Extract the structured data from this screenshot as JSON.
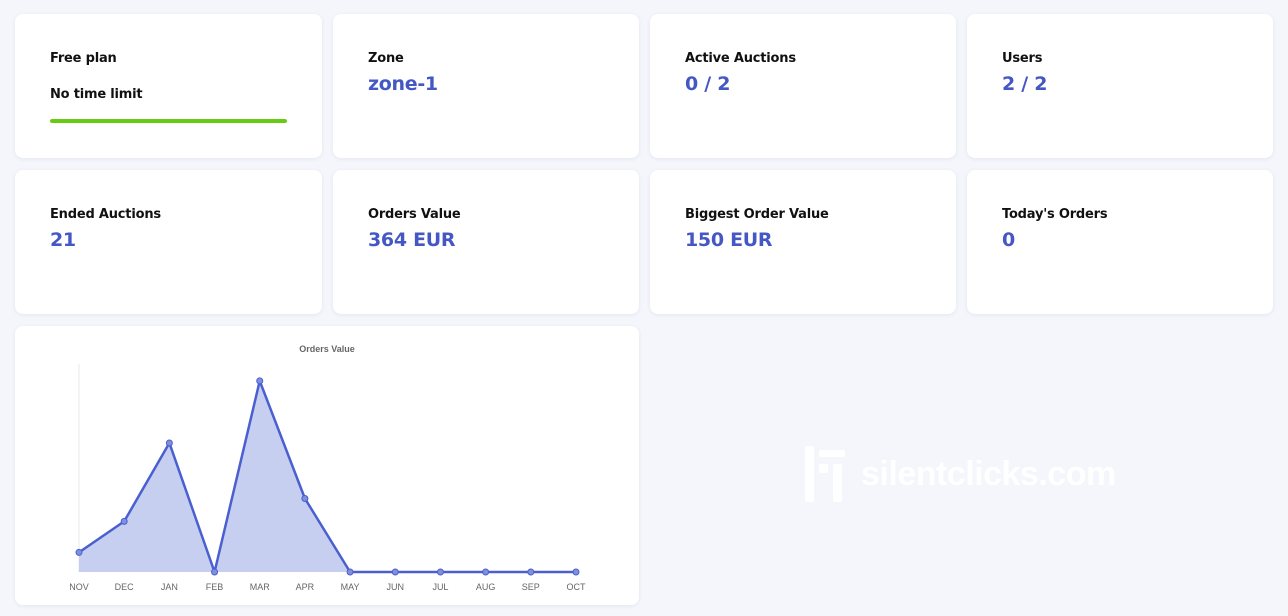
{
  "colors": {
    "background": "#f4f6fc",
    "card": "#ffffff",
    "accent": "#4457c4",
    "plan_bar": "#66cc11",
    "chart_line": "#4a5fd0",
    "chart_fill": "#c7cff0"
  },
  "plan": {
    "title": "Free plan",
    "subtitle": "No time limit",
    "progress": 1.0
  },
  "stats": {
    "zone": {
      "label": "Zone",
      "value": "zone-1"
    },
    "active_auctions": {
      "label": "Active Auctions",
      "value": "0 / 2"
    },
    "users": {
      "label": "Users",
      "value": "2 / 2"
    },
    "ended_auctions": {
      "label": "Ended Auctions",
      "value": "21"
    },
    "orders_value": {
      "label": "Orders Value",
      "value": "364 EUR"
    },
    "biggest_order": {
      "label": "Biggest Order Value",
      "value": "150 EUR"
    },
    "todays_orders": {
      "label": "Today's Orders",
      "value": "0"
    }
  },
  "watermark": {
    "text": "silentclicks.com",
    "icon": "silentclicks-logo-icon"
  },
  "chart_data": {
    "type": "area",
    "title": "Orders Value",
    "xlabel": "",
    "ylabel": "",
    "categories": [
      "NOV",
      "DEC",
      "JAN",
      "FEB",
      "MAR",
      "APR",
      "MAY",
      "JUN",
      "JUL",
      "AUG",
      "SEP",
      "OCT"
    ],
    "series": [
      {
        "values": [
          12,
          31,
          79,
          0,
          117,
          45,
          0,
          0,
          0,
          0,
          0,
          0
        ]
      }
    ],
    "ylim": [
      0,
      120
    ],
    "grid": false,
    "legend": "none"
  }
}
